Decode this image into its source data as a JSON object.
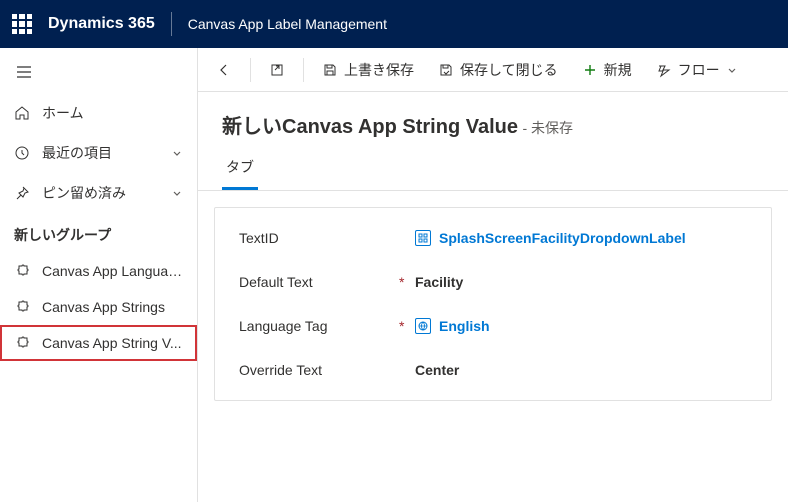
{
  "header": {
    "brand": "Dynamics 365",
    "app_name": "Canvas App Label Management"
  },
  "sidebar": {
    "home": "ホーム",
    "recent": "最近の項目",
    "pinned": "ピン留め済み",
    "group_header": "新しいグループ",
    "items": [
      "Canvas App Languag...",
      "Canvas App Strings",
      "Canvas App String V..."
    ]
  },
  "commands": {
    "save": "上書き保存",
    "save_close": "保存して閉じる",
    "new": "新規",
    "flow": "フロー"
  },
  "page": {
    "title": "新しいCanvas App String Value",
    "status": "- 未保存",
    "tab": "タブ"
  },
  "form": {
    "textid_label": "TextID",
    "textid_value": "SplashScreenFacilityDropdownLabel",
    "default_text_label": "Default Text",
    "default_text_value": "Facility",
    "language_tag_label": "Language Tag",
    "language_tag_value": "English",
    "override_text_label": "Override Text",
    "override_text_value": "Center"
  }
}
